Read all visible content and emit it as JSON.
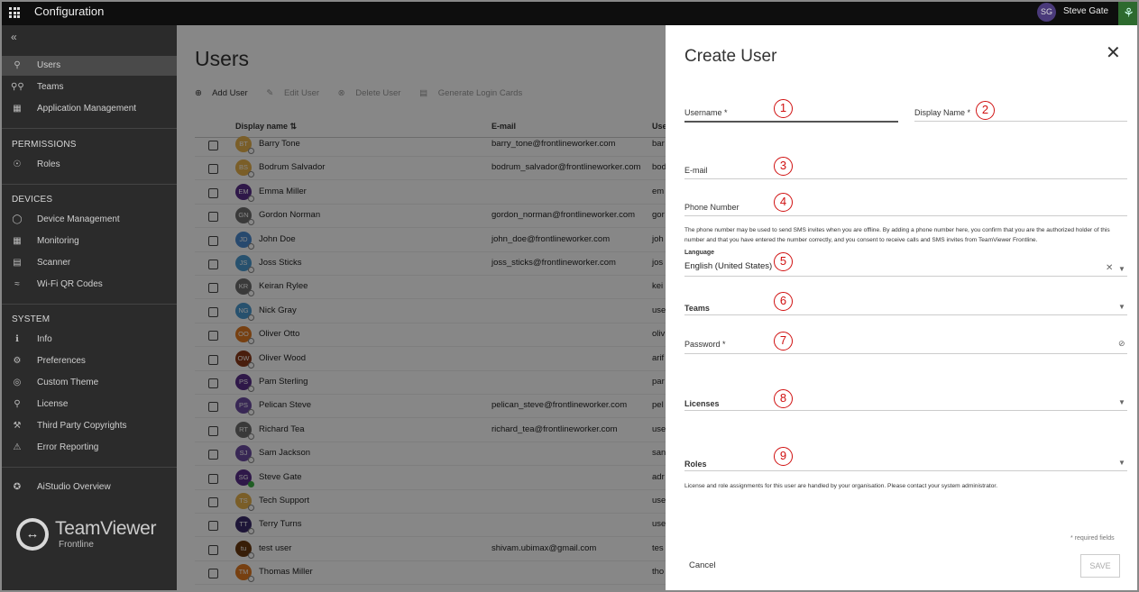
{
  "topbar": {
    "app_title": "Configuration",
    "user_initials": "SG",
    "user_name": "Steve Gate"
  },
  "sidebar": {
    "main_items": [
      {
        "label": "Users",
        "icon": "user-icon",
        "active": true
      },
      {
        "label": "Teams",
        "icon": "teams-icon"
      },
      {
        "label": "Application Management",
        "icon": "apps-icon"
      }
    ],
    "permissions_header": "PERMISSIONS",
    "permissions_items": [
      {
        "label": "Roles",
        "icon": "roles-icon"
      }
    ],
    "devices_header": "DEVICES",
    "devices_items": [
      {
        "label": "Device Management",
        "icon": "shield-icon"
      },
      {
        "label": "Monitoring",
        "icon": "monitoring-icon"
      },
      {
        "label": "Scanner",
        "icon": "scanner-icon"
      },
      {
        "label": "Wi-Fi QR Codes",
        "icon": "wifi-icon"
      }
    ],
    "system_header": "SYSTEM",
    "system_items": [
      {
        "label": "Info",
        "icon": "info-icon"
      },
      {
        "label": "Preferences",
        "icon": "gear-icon"
      },
      {
        "label": "Custom Theme",
        "icon": "palette-icon"
      },
      {
        "label": "License",
        "icon": "license-icon"
      },
      {
        "label": "Third Party Copyrights",
        "icon": "gavel-icon"
      },
      {
        "label": "Error Reporting",
        "icon": "warning-icon"
      }
    ],
    "extra_items": [
      {
        "label": "AiStudio Overview",
        "icon": "aistudio-icon"
      }
    ],
    "logo": {
      "name": "TeamViewer",
      "sub": "Frontline"
    }
  },
  "main": {
    "title": "Users",
    "toolbar": {
      "add": "Add User",
      "edit": "Edit User",
      "delete": "Delete User",
      "generate": "Generate Login Cards"
    },
    "columns": {
      "display_name": "Display name",
      "email": "E-mail",
      "username": "Use"
    },
    "rows": [
      {
        "initials": "BT",
        "name": "Barry Tone",
        "email": "barry_tone@frontlineworker.com",
        "user": "bar",
        "color": "#e6b14d"
      },
      {
        "initials": "BS",
        "name": "Bodrum Salvador",
        "email": "bodrum_salvador@frontlineworker.com",
        "user": "bod",
        "color": "#e6b14d"
      },
      {
        "initials": "EM",
        "name": "Emma Miller",
        "email": "",
        "user": "em",
        "color": "#5a2f8a"
      },
      {
        "initials": "GN",
        "name": "Gordon Norman",
        "email": "gordon_norman@frontlineworker.com",
        "user": "gor",
        "color": "#6e6e6e"
      },
      {
        "initials": "JD",
        "name": "John Doe",
        "email": "john_doe@frontlineworker.com",
        "user": "joh",
        "color": "#4a8ad0"
      },
      {
        "initials": "JS",
        "name": "Joss Sticks",
        "email": "joss_sticks@frontlineworker.com",
        "user": "jos",
        "color": "#4a9ad0"
      },
      {
        "initials": "KR",
        "name": "Keiran Rylee",
        "email": "",
        "user": "kei",
        "color": "#6e6e6e"
      },
      {
        "initials": "NG",
        "name": "Nick Gray",
        "email": "",
        "user": "use",
        "color": "#4a9ad0"
      },
      {
        "initials": "OO",
        "name": "Oliver Otto",
        "email": "",
        "user": "oliv",
        "color": "#e07a20"
      },
      {
        "initials": "OW",
        "name": "Oliver Wood",
        "email": "",
        "user": "arif",
        "color": "#8a3a1a"
      },
      {
        "initials": "PS",
        "name": "Pam Sterling",
        "email": "",
        "user": "par",
        "color": "#5a2f8a"
      },
      {
        "initials": "PS",
        "name": "Pelican Steve",
        "email": "pelican_steve@frontlineworker.com",
        "user": "pel",
        "color": "#6a4aa0"
      },
      {
        "initials": "RT",
        "name": "Richard Tea",
        "email": "richard_tea@frontlineworker.com",
        "user": "use",
        "color": "#6e6e6e"
      },
      {
        "initials": "SJ",
        "name": "Sam Jackson",
        "email": "",
        "user": "san",
        "color": "#6a4aa0"
      },
      {
        "initials": "SG",
        "name": "Steve Gate",
        "email": "",
        "user": "adr",
        "color": "#5a2f8a"
      },
      {
        "initials": "TS",
        "name": "Tech Support",
        "email": "",
        "user": "use",
        "color": "#e6b14d"
      },
      {
        "initials": "TT",
        "name": "Terry Turns",
        "email": "",
        "user": "use",
        "color": "#3a2a6a"
      },
      {
        "initials": "tu",
        "name": "test user",
        "email": "shivam.ubimax@gmail.com",
        "user": "tes",
        "color": "#6a3a10"
      },
      {
        "initials": "TM",
        "name": "Thomas Miller",
        "email": "",
        "user": "tho",
        "color": "#e07a20"
      }
    ]
  },
  "dialog": {
    "title": "Create User",
    "username_label": "Username *",
    "display_name_label": "Display Name *",
    "email_label": "E-mail",
    "phone_label": "Phone Number",
    "phone_help": "The phone number may be used to send SMS invites when you are offline. By adding a phone number here, you confirm that you are the authorized holder of this number and that you have entered the number correctly, and you consent to receive calls and SMS invites from TeamViewer Frontline.",
    "language_label": "Language",
    "language_value": "English (United States)",
    "teams_label": "Teams",
    "password_label": "Password *",
    "licenses_label": "Licenses",
    "roles_label": "Roles",
    "license_note": "License and role assignments for this user are handled by your organisation. Please contact your system administrator.",
    "required_note": "* required fields",
    "cancel": "Cancel",
    "save": "SAVE",
    "markers": [
      "1",
      "2",
      "3",
      "4",
      "5",
      "6",
      "7",
      "8",
      "9"
    ]
  }
}
